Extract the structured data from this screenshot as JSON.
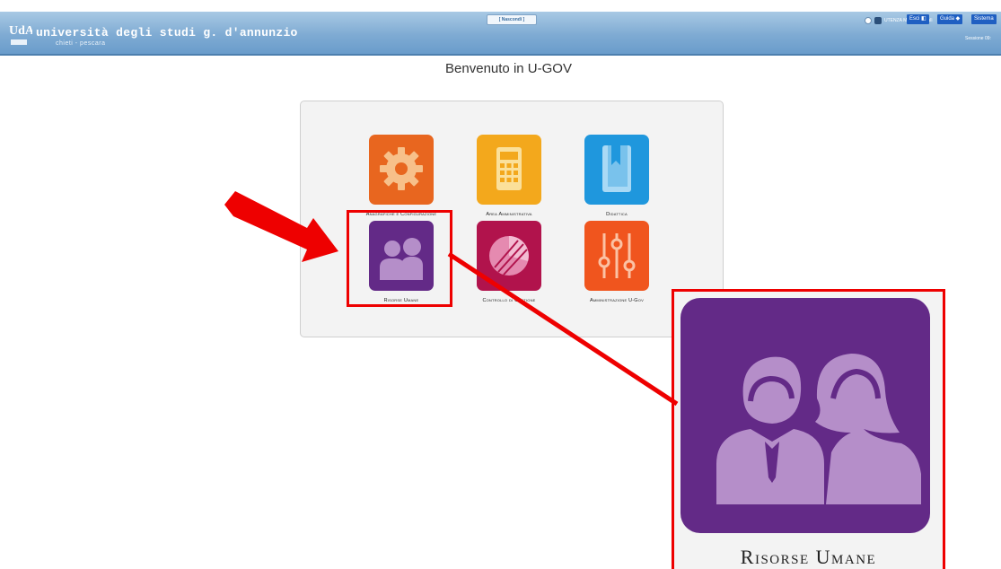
{
  "header": {
    "logo_mark": "UdA",
    "university_name": "università degli studi g. d'annunzio",
    "university_sub": "chieti - pescara",
    "center_button": "[ Nascondi ]",
    "user_label": "UTENZA ME - Nero Zulì",
    "exit_label": "Esci",
    "guide_label": "Guida",
    "system_label": "Sistema",
    "session_label": "Sessione 09:"
  },
  "welcome": "Benvenuto in U-GOV",
  "tiles": [
    {
      "label": "Anagrafiche e Configurazione",
      "icon": "gear-icon",
      "color": "#e8661f"
    },
    {
      "label": "Area Amministrativa",
      "icon": "calculator-icon",
      "color": "#f3a81c"
    },
    {
      "label": "Didattica",
      "icon": "book-icon",
      "color": "#1f97dd"
    },
    {
      "label": "Risorse Umane",
      "icon": "people-icon",
      "color": "#632a87"
    },
    {
      "label": "Controllo di Gestione",
      "icon": "pie-chart-icon",
      "color": "#b1134c"
    },
    {
      "label": "Amministrazione U-Gov",
      "icon": "sliders-icon",
      "color": "#f0551e"
    }
  ],
  "zoom": {
    "label": "Risorse Umane",
    "icon": "people-icon",
    "color": "#632a87"
  },
  "annotation_color": "#ee0000"
}
